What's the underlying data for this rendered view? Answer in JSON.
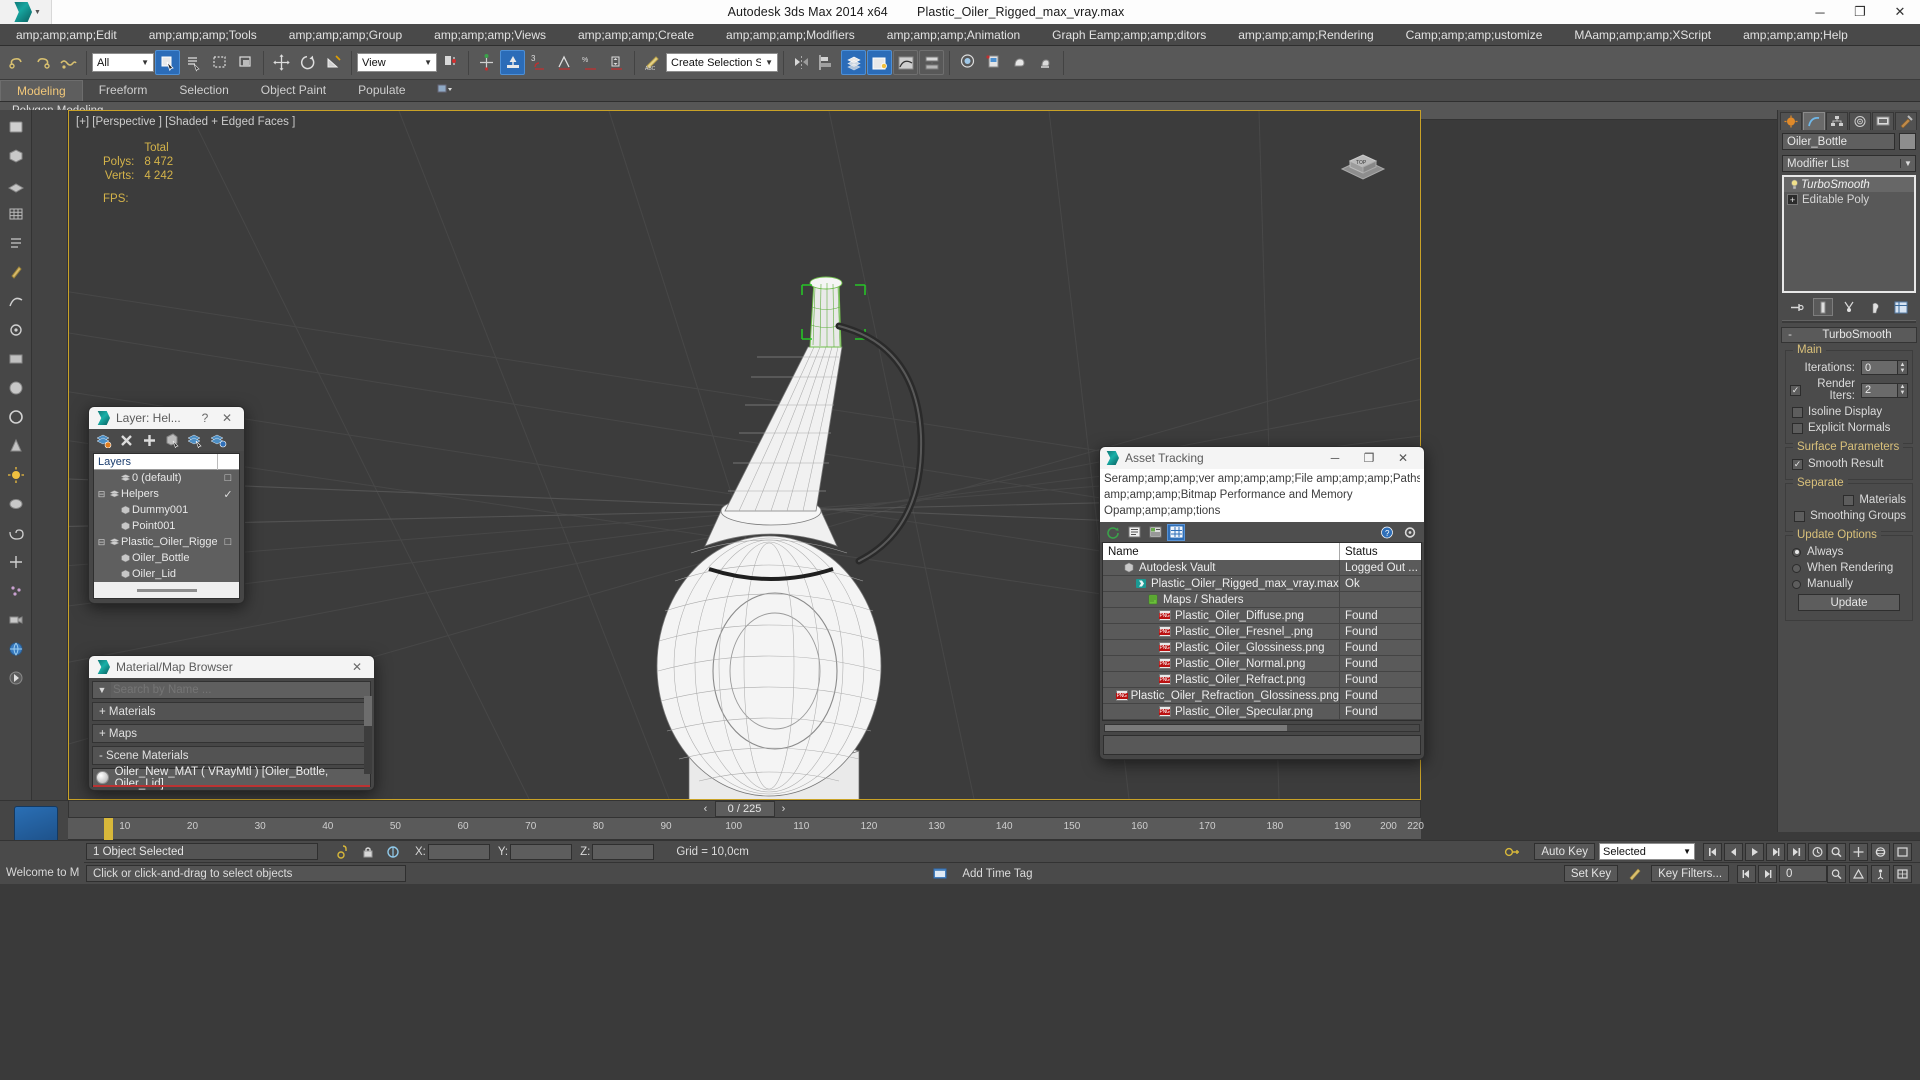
{
  "titlebar": {
    "app_title": "Autodesk 3ds Max  2014 x64",
    "file_title": "Plastic_Oiler_Rigged_max_vray.max",
    "minimize": "─",
    "maximize": "❐",
    "close": "✕"
  },
  "menubar": {
    "items": [
      "amp;amp;amp;Edit",
      "amp;amp;amp;Tools",
      "amp;amp;amp;Group",
      "amp;amp;amp;Views",
      "amp;amp;amp;Create",
      "amp;amp;amp;Modifiers",
      "amp;amp;amp;Animation",
      "Graph Eamp;amp;amp;ditors",
      "amp;amp;amp;Rendering",
      "Camp;amp;amp;ustomize",
      "MAamp;amp;amp;XScript",
      "amp;amp;amp;Help"
    ]
  },
  "toolbar": {
    "selection_filter": "All",
    "reference_coord": "View",
    "named_selection_set": "Create Selection Se",
    "angle_snap_value": "3"
  },
  "ribbon": {
    "tabs": [
      "Modeling",
      "Freeform",
      "Selection",
      "Object Paint",
      "Populate"
    ],
    "active_tab": "Modeling",
    "subtitle": "Polygon Modeling"
  },
  "viewport": {
    "label": "[+] [Perspective ] [Shaded + Edged Faces ]",
    "stats_header": "Total",
    "polys_label": "Polys:",
    "polys_value": "8 472",
    "verts_label": "Verts:",
    "verts_value": "4 242",
    "fps_label": "FPS:",
    "fps_value": ""
  },
  "layer_dialog": {
    "title": "Layer: Hel...",
    "help": "?",
    "close": "✕",
    "column_header": "Layers",
    "rows": [
      {
        "name": "0 (default)",
        "indent": 1,
        "expander": "",
        "icon": "layer-icon",
        "mark": "□"
      },
      {
        "name": "Helpers",
        "indent": 0,
        "expander": "⊟",
        "icon": "layer-icon",
        "mark": "✓"
      },
      {
        "name": "Dummy001",
        "indent": 2,
        "expander": "",
        "icon": "object-icon",
        "mark": ""
      },
      {
        "name": "Point001",
        "indent": 2,
        "expander": "",
        "icon": "object-icon",
        "mark": ""
      },
      {
        "name": "Plastic_Oiler_Rigged",
        "indent": 0,
        "expander": "⊟",
        "icon": "layer-icon",
        "mark": "□"
      },
      {
        "name": "Oiler_Bottle",
        "indent": 2,
        "expander": "",
        "icon": "object-icon",
        "mark": ""
      },
      {
        "name": "Oiler_Lid",
        "indent": 2,
        "expander": "",
        "icon": "object-icon",
        "mark": ""
      }
    ]
  },
  "material_browser": {
    "title": "Material/Map Browser",
    "close": "✕",
    "search_placeholder": "Search by Name ...",
    "groups": [
      {
        "label": "+ Materials"
      },
      {
        "label": "+ Maps"
      },
      {
        "label": "- Scene Materials"
      }
    ],
    "scene_material": "Oiler_New_MAT  ( VRayMtl )  [Oiler_Bottle, Oiler_Lid]"
  },
  "asset_tracking": {
    "title": "Asset Tracking",
    "minimize": "─",
    "maximize": "❐",
    "close": "✕",
    "menu_lines": [
      "Seramp;amp;amp;ver      amp;amp;amp;File      amp;amp;amp;Paths",
      "amp;amp;amp;Bitmap Performance and Memory",
      "Opamp;amp;amp;tions"
    ],
    "columns": [
      "Name",
      "Status"
    ],
    "rows": [
      {
        "name": "Autodesk Vault",
        "status": "Logged Out ...",
        "indent": 1,
        "icon": "vault-icon"
      },
      {
        "name": "Plastic_Oiler_Rigged_max_vray.max",
        "status": "Ok",
        "indent": 2,
        "icon": "max-file-icon"
      },
      {
        "name": "Maps / Shaders",
        "status": "",
        "indent": 3,
        "icon": "maps-icon"
      },
      {
        "name": "Plastic_Oiler_Diffuse.png",
        "status": "Found",
        "indent": 4,
        "icon": "png-icon"
      },
      {
        "name": "Plastic_Oiler_Fresnel_.png",
        "status": "Found",
        "indent": 4,
        "icon": "png-icon"
      },
      {
        "name": "Plastic_Oiler_Glossiness.png",
        "status": "Found",
        "indent": 4,
        "icon": "png-icon"
      },
      {
        "name": "Plastic_Oiler_Normal.png",
        "status": "Found",
        "indent": 4,
        "icon": "png-icon"
      },
      {
        "name": "Plastic_Oiler_Refract.png",
        "status": "Found",
        "indent": 4,
        "icon": "png-icon"
      },
      {
        "name": "Plastic_Oiler_Refraction_Glossiness.png",
        "status": "Found",
        "indent": 4,
        "icon": "png-icon"
      },
      {
        "name": "Plastic_Oiler_Specular.png",
        "status": "Found",
        "indent": 4,
        "icon": "png-icon"
      }
    ]
  },
  "command_panel": {
    "object_name": "Oiler_Bottle",
    "modifier_list_label": "Modifier List",
    "stack": [
      {
        "label": "TurboSmooth",
        "selected": true
      },
      {
        "label": "Editable Poly",
        "selected": false
      }
    ],
    "rollout": {
      "title": "TurboSmooth",
      "collapse_mark": "-",
      "main_caption": "Main",
      "iterations_label": "Iterations:",
      "iterations_value": "0",
      "render_iters_label": "Render Iters:",
      "render_iters_value": "2",
      "render_iters_checked": true,
      "isoline_label": "Isoline Display",
      "explicit_normals_label": "Explicit Normals",
      "surface_caption": "Surface Parameters",
      "smooth_result_label": "Smooth Result",
      "smooth_result_checked": true,
      "separate_caption": "Separate",
      "materials_label": "Materials",
      "smoothing_groups_label": "Smoothing Groups",
      "update_caption": "Update Options",
      "update_always": "Always",
      "update_when_rendering": "When Rendering",
      "update_manually": "Manually",
      "update_selected": "Always",
      "update_button": "Update"
    }
  },
  "timeline": {
    "current_frame": "0 / 225",
    "prev_arrow": "‹",
    "next_arrow": "›",
    "ticks": [
      {
        "label": "10",
        "pos": 4.2
      },
      {
        "label": "20",
        "pos": 9.2
      },
      {
        "label": "30",
        "pos": 14.2
      },
      {
        "label": "40",
        "pos": 19.2
      },
      {
        "label": "50",
        "pos": 24.2
      },
      {
        "label": "60",
        "pos": 29.2
      },
      {
        "label": "70",
        "pos": 34.2
      },
      {
        "label": "80",
        "pos": 39.2
      },
      {
        "label": "90",
        "pos": 44.2
      },
      {
        "label": "100",
        "pos": 49.2
      },
      {
        "label": "110",
        "pos": 54.2
      },
      {
        "label": "120",
        "pos": 59.2
      },
      {
        "label": "130",
        "pos": 64.2
      },
      {
        "label": "140",
        "pos": 69.2
      },
      {
        "label": "150",
        "pos": 74.2
      },
      {
        "label": "160",
        "pos": 79.2
      },
      {
        "label": "170",
        "pos": 84.2
      },
      {
        "label": "180",
        "pos": 89.2
      },
      {
        "label": "190",
        "pos": 94.2
      },
      {
        "label": "200",
        "pos": 97.6
      },
      {
        "label": "220",
        "pos": 99.6
      }
    ]
  },
  "statusbar": {
    "selection_text": "1 Object Selected",
    "hint_text": "Click or click-and-drag to select objects",
    "welcome_text": "Welcome to M",
    "x_label": "X:",
    "y_label": "Y:",
    "z_label": "Z:",
    "x_value": "",
    "y_value": "",
    "z_value": "",
    "grid_text": "Grid = 10,0cm",
    "auto_key": "Auto Key",
    "set_key": "Set Key",
    "key_filters": "Key Filters...",
    "selected_dropdown": "Selected",
    "add_time_tag": "Add Time Tag",
    "frame_field": "0"
  },
  "colors": {
    "accent_gold": "#c9a227",
    "highlight_blue": "#2b6cb8",
    "stats_text": "#d4b34a",
    "panel_bg": "#4b4b4b",
    "viewport_bg": "#3c3c3c"
  }
}
